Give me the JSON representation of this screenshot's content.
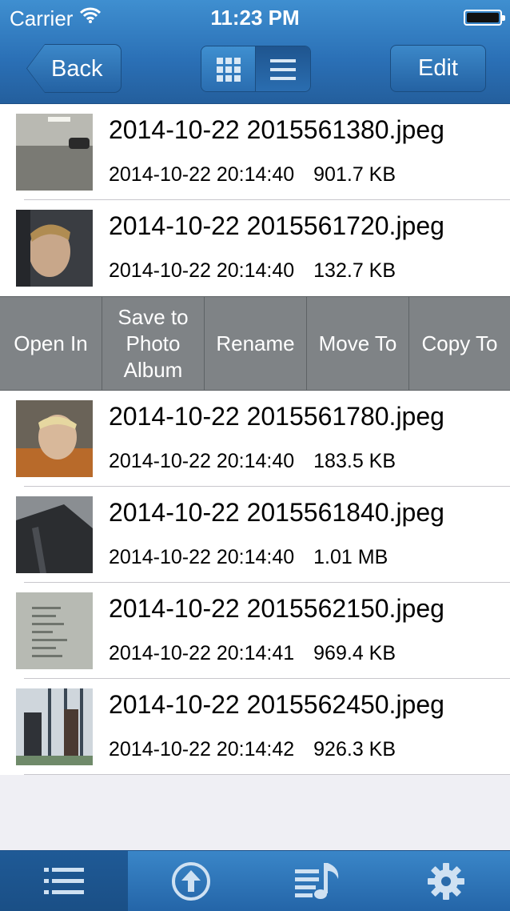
{
  "status": {
    "carrier": "Carrier",
    "time": "11:23 PM"
  },
  "nav": {
    "back_label": "Back",
    "edit_label": "Edit"
  },
  "files": [
    {
      "name": "2014-10-22 2015561380.jpeg",
      "date": "2014-10-22 20:14:40",
      "size": "901.7 KB"
    },
    {
      "name": "2014-10-22 2015561720.jpeg",
      "date": "2014-10-22 20:14:40",
      "size": "132.7 KB"
    },
    {
      "name": "2014-10-22 2015561780.jpeg",
      "date": "2014-10-22 20:14:40",
      "size": "183.5 KB"
    },
    {
      "name": "2014-10-22 2015561840.jpeg",
      "date": "2014-10-22 20:14:40",
      "size": "1.01 MB"
    },
    {
      "name": "2014-10-22 2015562150.jpeg",
      "date": "2014-10-22 20:14:41",
      "size": "969.4 KB"
    },
    {
      "name": "2014-10-22 2015562450.jpeg",
      "date": "2014-10-22 20:14:42",
      "size": "926.3 KB"
    }
  ],
  "actions": {
    "open_in": "Open In",
    "save_line1": "Save to",
    "save_line2": "Photo",
    "save_line3": "Album",
    "rename": "Rename",
    "move_to": "Move To",
    "copy_to": "Copy To"
  },
  "tabs": [
    "list-icon",
    "upload-icon",
    "music-playlist-icon",
    "gear-icon"
  ],
  "colors": {
    "nav_blue": "#2a6fb5",
    "action_gray": "#7f8386",
    "background": "#efeff4"
  }
}
